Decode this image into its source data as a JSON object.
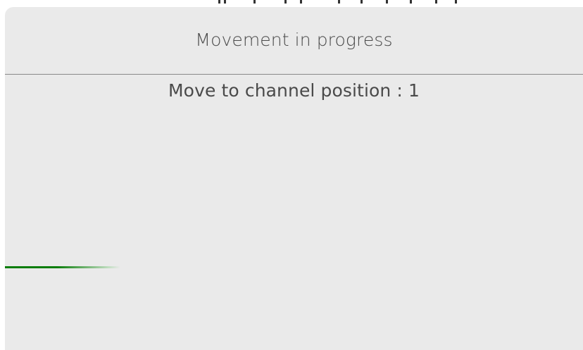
{
  "dialog": {
    "title": "Movement in progress",
    "message": "Move to channel position : 1"
  },
  "progress": {
    "fraction": 0.2,
    "indeterminate": true,
    "color": "#0a7d0a"
  },
  "colors": {
    "dialog_background": "#eaeaea",
    "text": "#4a4a4a",
    "divider": "#8a8a8a"
  }
}
